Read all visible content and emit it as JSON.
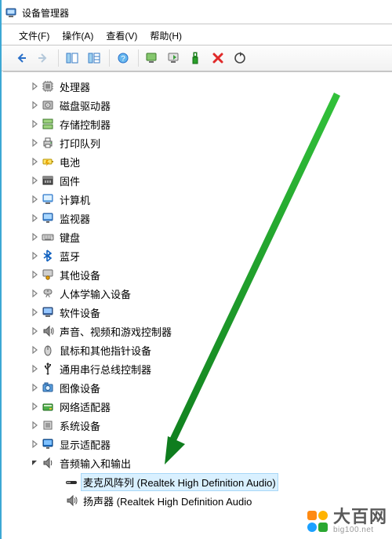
{
  "window": {
    "title": "设备管理器"
  },
  "menu": {
    "file": "文件(F)",
    "action": "操作(A)",
    "view": "查看(V)",
    "help": "帮助(H)"
  },
  "toolbar": {
    "btn_back": "back",
    "btn_forward": "forward",
    "btn_details": "details",
    "btn_tiles": "tiles",
    "btn_help": "help",
    "btn_refresh": "refresh",
    "btn_enable": "enable",
    "btn_remove": "remove",
    "btn_update": "update"
  },
  "tree": {
    "categories": [
      {
        "icon": "cpu",
        "label": "处理器"
      },
      {
        "icon": "disk",
        "label": "磁盘驱动器"
      },
      {
        "icon": "storage",
        "label": "存储控制器"
      },
      {
        "icon": "printer",
        "label": "打印队列"
      },
      {
        "icon": "battery",
        "label": "电池"
      },
      {
        "icon": "firmware",
        "label": "固件"
      },
      {
        "icon": "computer",
        "label": "计算机"
      },
      {
        "icon": "monitor",
        "label": "监视器"
      },
      {
        "icon": "keyboard",
        "label": "键盘"
      },
      {
        "icon": "bluetooth",
        "label": "蓝牙"
      },
      {
        "icon": "other",
        "label": "其他设备"
      },
      {
        "icon": "hid",
        "label": "人体学输入设备"
      },
      {
        "icon": "software",
        "label": "软件设备"
      },
      {
        "icon": "sound",
        "label": "声音、视频和游戏控制器"
      },
      {
        "icon": "mouse",
        "label": "鼠标和其他指针设备"
      },
      {
        "icon": "usb",
        "label": "通用串行总线控制器"
      },
      {
        "icon": "imaging",
        "label": "图像设备"
      },
      {
        "icon": "network",
        "label": "网络适配器"
      },
      {
        "icon": "system",
        "label": "系统设备"
      },
      {
        "icon": "display",
        "label": "显示适配器"
      }
    ],
    "expanded": {
      "icon": "audioio",
      "label": "音频输入和输出",
      "children": [
        {
          "icon": "mic",
          "label": "麦克风阵列 (Realtek High Definition Audio)",
          "selected": true
        },
        {
          "icon": "speaker",
          "label": "扬声器 (Realtek High Definition Audio"
        }
      ]
    }
  },
  "watermark": {
    "name": "大百网",
    "sub": "big100.net"
  }
}
